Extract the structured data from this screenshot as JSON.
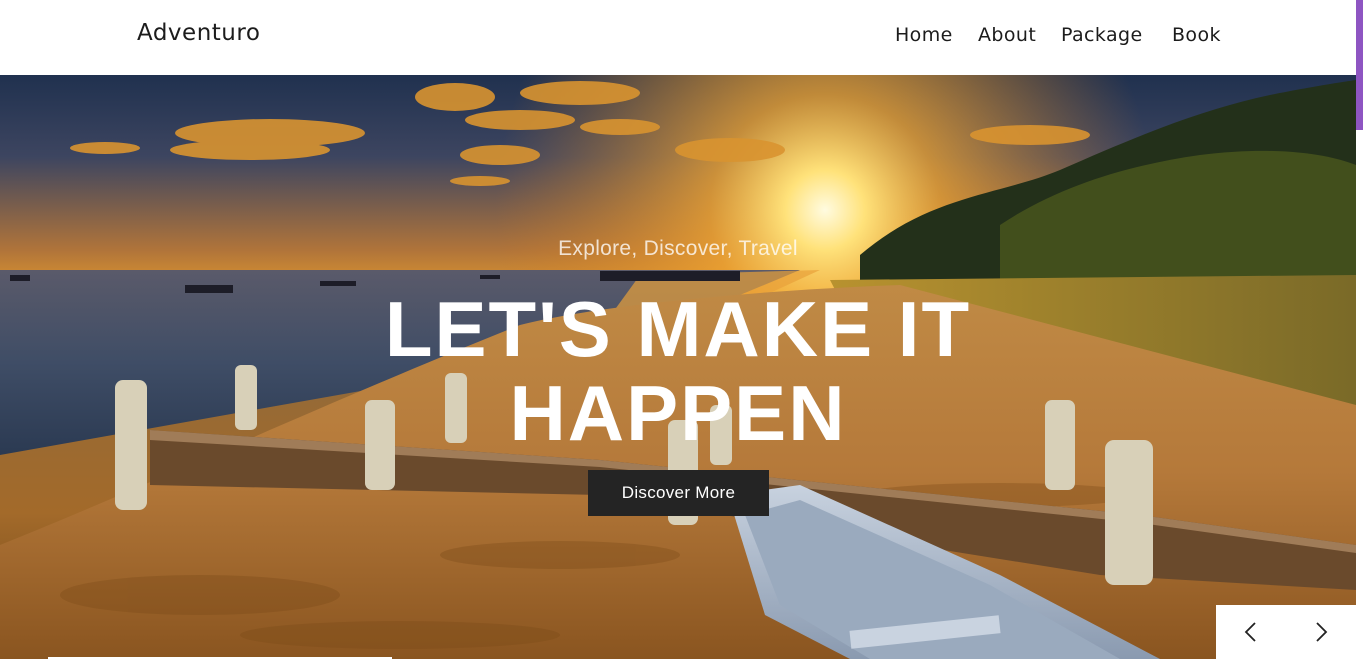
{
  "brand": {
    "name": "Adventuro"
  },
  "nav": {
    "items": [
      {
        "label": "Home"
      },
      {
        "label": "About"
      },
      {
        "label": "Package"
      },
      {
        "label": "Book"
      }
    ]
  },
  "hero": {
    "tagline": "Explore, Discover, Travel",
    "headline": "LET'S MAKE IT HAPPEN",
    "cta_label": "Discover More",
    "background": "sunset beach with wooden pier and rowboat"
  },
  "carousel": {
    "prev_icon": "chevron-left-icon",
    "next_icon": "chevron-right-icon"
  },
  "colors": {
    "header_bg": "#ffffff",
    "cta_bg": "#242424",
    "text_dark": "#1c1c1c",
    "scrollbar_thumb": "#8e55c2"
  }
}
